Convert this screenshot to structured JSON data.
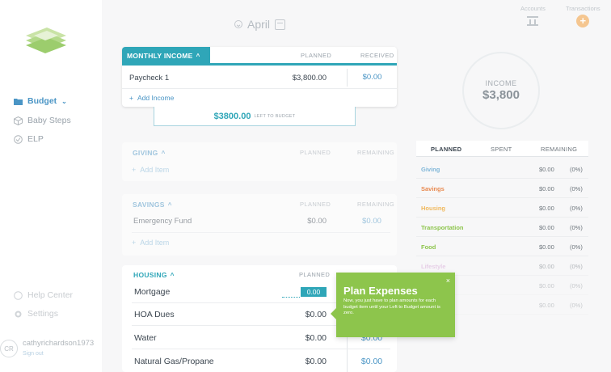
{
  "sidebar": {
    "nav": [
      {
        "label": "Budget",
        "icon": "folder-icon"
      },
      {
        "label": "Baby Steps",
        "icon": "cube-icon"
      },
      {
        "label": "ELP",
        "icon": "shield-icon"
      },
      {
        "label": "Help Center",
        "icon": "help-icon"
      },
      {
        "label": "Settings",
        "icon": "gear-icon"
      }
    ],
    "user": {
      "initials": "CR",
      "name": "cathyrichardson1973",
      "signout": "Sign out"
    }
  },
  "header": {
    "month": "April",
    "accounts_label": "Accounts",
    "transactions_label": "Transactions",
    "add_symbol": "+"
  },
  "income": {
    "title": "MONTHLY INCOME",
    "col_planned": "PLANNED",
    "col_received": "RECEIVED",
    "rows": [
      {
        "name": "Paycheck 1",
        "planned": "$3,800.00",
        "received": "$0.00"
      }
    ],
    "add_label": "Add Income",
    "left_amount": "$3800.00",
    "left_label": "LEFT TO BUDGET"
  },
  "giving": {
    "title": "GIVING",
    "col_planned": "PLANNED",
    "col_remaining": "REMAINING",
    "add_label": "Add Item"
  },
  "savings": {
    "title": "SAVINGS",
    "col_planned": "PLANNED",
    "col_remaining": "REMAINING",
    "rows": [
      {
        "name": "Emergency Fund",
        "planned": "$0.00",
        "remaining": "$0.00"
      }
    ],
    "add_label": "Add Item"
  },
  "housing": {
    "title": "HOUSING",
    "col_planned": "PLANNED",
    "rows": [
      {
        "name": "Mortgage",
        "planned": "0.00",
        "remaining": ""
      },
      {
        "name": "HOA Dues",
        "planned": "$0.00",
        "remaining": ""
      },
      {
        "name": "Water",
        "planned": "$0.00",
        "remaining": "$0.00"
      },
      {
        "name": "Natural Gas/Propane",
        "planned": "$0.00",
        "remaining": "$0.00"
      }
    ]
  },
  "summary": {
    "income_label": "INCOME",
    "income_value": "$3,800",
    "cols": [
      "PLANNED",
      "SPENT",
      "REMAINING"
    ],
    "rows": [
      {
        "cat": "Giving",
        "amount": "$0.00",
        "pct": "(0%)",
        "color": "#7fb6d8"
      },
      {
        "cat": "Savings",
        "amount": "$0.00",
        "pct": "(0%)",
        "color": "#e8884e"
      },
      {
        "cat": "Housing",
        "amount": "$0.00",
        "pct": "(0%)",
        "color": "#f0b85c"
      },
      {
        "cat": "Transportation",
        "amount": "$0.00",
        "pct": "(0%)",
        "color": "#8dc54c"
      },
      {
        "cat": "Food",
        "amount": "$0.00",
        "pct": "(0%)",
        "color": "#8dc54c"
      },
      {
        "cat": "Lifestyle",
        "amount": "$0.00",
        "pct": "(0%)",
        "color": "#d6a6d6"
      },
      {
        "cat": "",
        "amount": "$0.00",
        "pct": "(0%)",
        "color": "#8b939a"
      },
      {
        "cat": "",
        "amount": "$0.00",
        "pct": "(0%)",
        "color": "#8b939a"
      }
    ]
  },
  "tooltip": {
    "title": "Plan Expenses",
    "text": "Now, you just have to plan amounts for each budget item until your Left to Budget amount is zero.",
    "close": "×"
  }
}
